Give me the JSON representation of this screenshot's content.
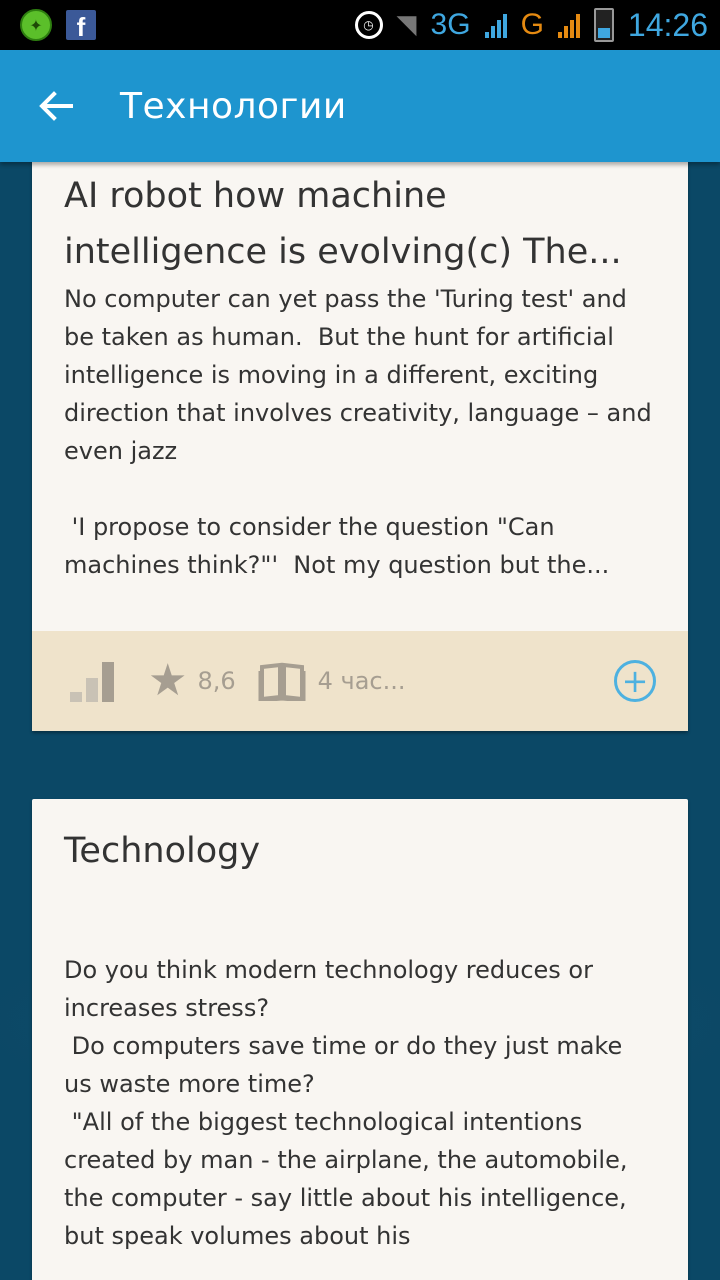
{
  "status_bar": {
    "network_1": "3G",
    "network_2": "G",
    "time": "14:26",
    "icons": [
      "shield-icon",
      "facebook-icon",
      "alarm-icon",
      "wifi-icon",
      "signal-icon",
      "battery-icon"
    ]
  },
  "app_bar": {
    "title": "Технологии"
  },
  "cards": [
    {
      "title": "AI robot how machine intelligence is evolving(c) The...",
      "body": "No computer can yet pass the 'Turing test' and be taken as human.  But the hunt for artificial intelligence is moving in a different, exciting direction that involves creativity, language – and even jazz\n\n 'I propose to consider the question \"Can machines think?\"'  Not my question but the...",
      "rating": "8,6",
      "read_time": "4 час...",
      "difficulty_level": 1,
      "difficulty_max": 3
    },
    {
      "title": "Technology",
      "body": "Do you think modern technology reduces or increases stress?\n Do computers save time or do they just make us waste more time?\n \"All of the biggest technological intentions created by man - the airplane, the automobile, the computer - say little about his intelligence, but speak volumes about his"
    }
  ],
  "colors": {
    "app_bar": "#1e95cf",
    "background": "#0b4866",
    "card": "#f9f6f2",
    "footer": "#efe3cb",
    "accent": "#4db1e0"
  }
}
